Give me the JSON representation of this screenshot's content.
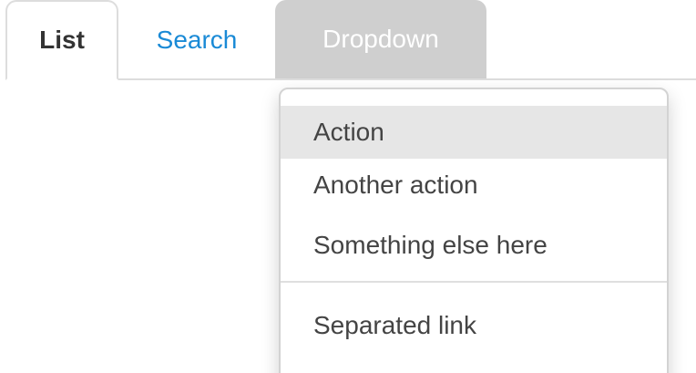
{
  "tabs": [
    {
      "label": "List",
      "state": "active"
    },
    {
      "label": "Search",
      "state": "link"
    },
    {
      "label": "Dropdown",
      "state": "open"
    }
  ],
  "dropdown_menu": {
    "items": [
      {
        "label": "Action",
        "highlighted": true
      },
      {
        "label": "Another action",
        "highlighted": false
      },
      {
        "label": "Something else here",
        "highlighted": false
      }
    ],
    "separated_items": [
      {
        "label": "Separated link"
      }
    ]
  },
  "colors": {
    "link": "#1a8ad6",
    "active_text": "#333333",
    "dropdown_tab_bg": "#cfcfcf",
    "menu_highlight": "#e6e6e6",
    "border": "#dddddd"
  }
}
